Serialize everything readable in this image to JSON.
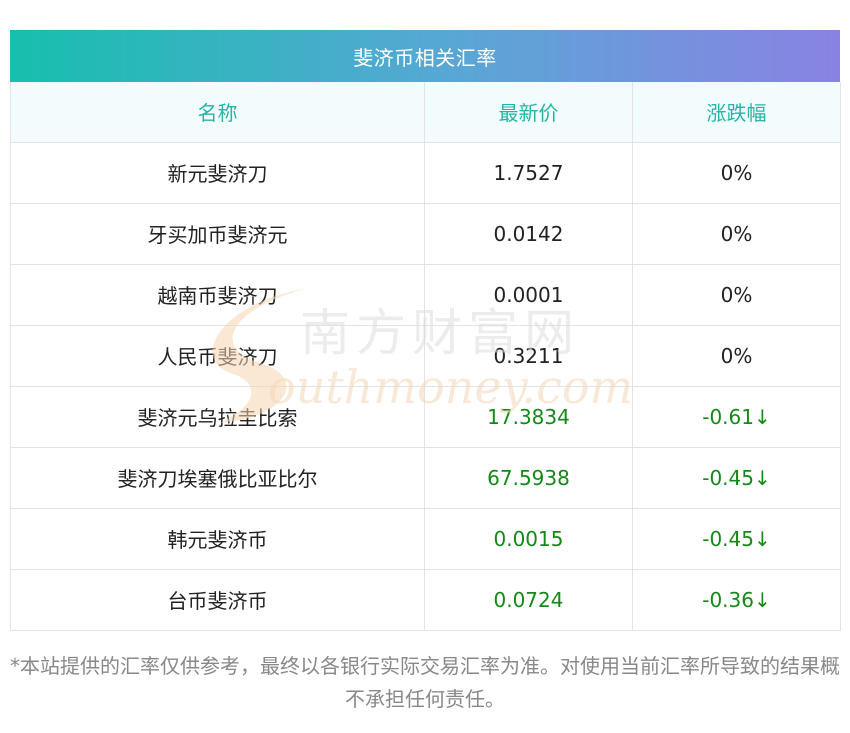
{
  "table": {
    "title": "斐济币相关汇率",
    "headers": [
      "名称",
      "最新价",
      "涨跌幅"
    ],
    "rows": [
      {
        "name": "新元斐济刀",
        "price": "1.7527",
        "change": "0%",
        "direction": "flat"
      },
      {
        "name": "牙买加币斐济元",
        "price": "0.0142",
        "change": "0%",
        "direction": "flat"
      },
      {
        "name": "越南币斐济刀",
        "price": "0.0001",
        "change": "0%",
        "direction": "flat"
      },
      {
        "name": "人民币斐济刀",
        "price": "0.3211",
        "change": "0%",
        "direction": "flat"
      },
      {
        "name": "斐济元乌拉圭比索",
        "price": "17.3834",
        "change": "-0.61↓",
        "direction": "down"
      },
      {
        "name": "斐济刀埃塞俄比亚比尔",
        "price": "67.5938",
        "change": "-0.45↓",
        "direction": "down"
      },
      {
        "name": "韩元斐济币",
        "price": "0.0015",
        "change": "-0.45↓",
        "direction": "down"
      },
      {
        "name": "台币斐济币",
        "price": "0.0724",
        "change": "-0.36↓",
        "direction": "down"
      }
    ]
  },
  "watermark": {
    "cn": "南方财富网",
    "en": "outhmoney.com"
  },
  "note": "*本站提供的汇率仅供参考，最终以各银行实际交易汇率为准。对使用当前汇率所导致的结果概不承担任何责任。",
  "colors": {
    "header_text": "#24b5a8",
    "down": "#138a18",
    "title_gradient_start": "#17bfae",
    "title_gradient_end": "#8a82e3"
  }
}
